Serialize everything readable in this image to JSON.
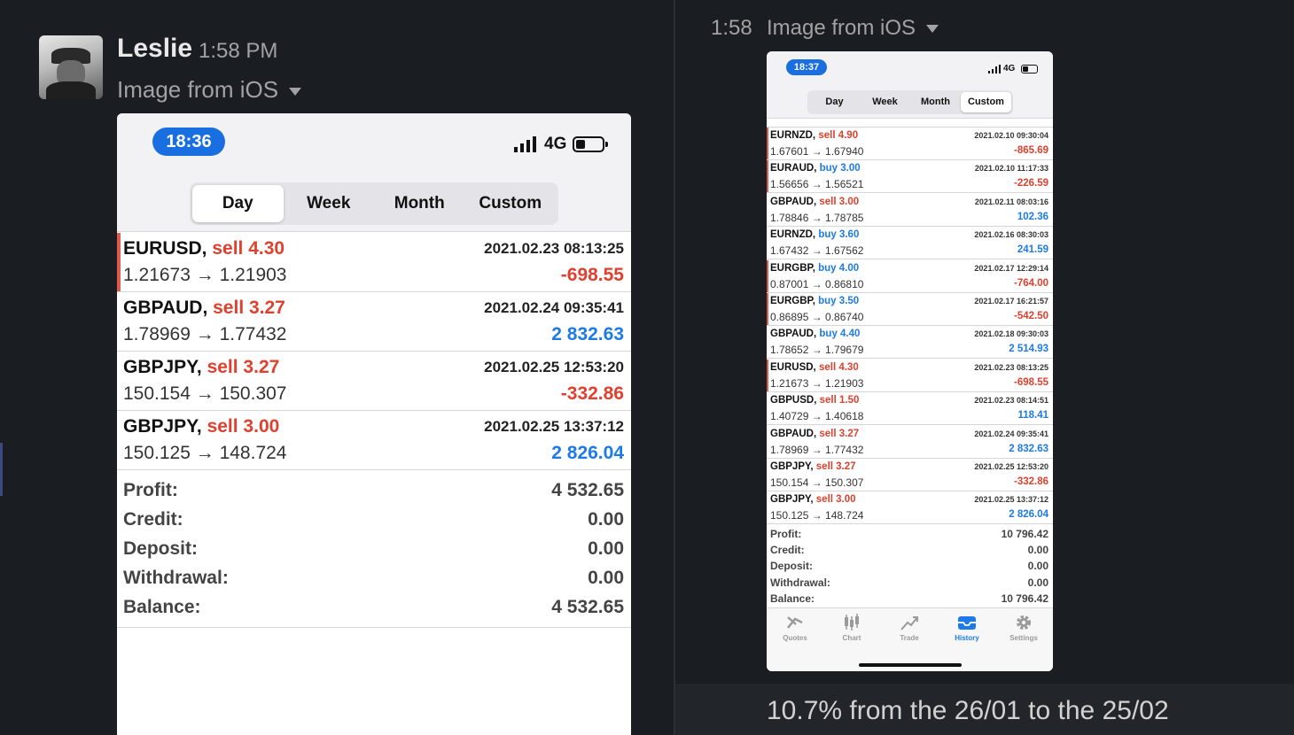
{
  "left_panel": {
    "author": "Leslie",
    "time": "1:58 PM",
    "file_label": "Image from iOS",
    "screenshot": {
      "clock": "18:36",
      "network": "4G",
      "tabs": [
        "Day",
        "Week",
        "Month",
        "Custom"
      ],
      "active_tab": "Day",
      "trades": [
        {
          "symbol": "EURUSD,",
          "side": "sell 4.30",
          "side_type": "sell",
          "date": "2021.02.23 08:13:25",
          "prices": "1.21673 → 1.21903",
          "pl": "-698.55",
          "pl_sign": "neg",
          "marked": true
        },
        {
          "symbol": "GBPAUD,",
          "side": "sell 3.27",
          "side_type": "sell",
          "date": "2021.02.24 09:35:41",
          "prices": "1.78969 → 1.77432",
          "pl": "2 832.63",
          "pl_sign": "pos",
          "marked": false
        },
        {
          "symbol": "GBPJPY,",
          "side": "sell 3.27",
          "side_type": "sell",
          "date": "2021.02.25 12:53:20",
          "prices": "150.154 → 150.307",
          "pl": "-332.86",
          "pl_sign": "neg",
          "marked": false
        },
        {
          "symbol": "GBPJPY,",
          "side": "sell 3.00",
          "side_type": "sell",
          "date": "2021.02.25 13:37:12",
          "prices": "150.125 → 148.724",
          "pl": "2 826.04",
          "pl_sign": "pos",
          "marked": false
        }
      ],
      "summary": [
        {
          "label": "Profit:",
          "value": "4 532.65"
        },
        {
          "label": "Credit:",
          "value": "0.00"
        },
        {
          "label": "Deposit:",
          "value": "0.00"
        },
        {
          "label": "Withdrawal:",
          "value": "0.00"
        },
        {
          "label": "Balance:",
          "value": "4 532.65"
        }
      ]
    }
  },
  "right_panel": {
    "time": "1:58",
    "file_label": "Image from iOS",
    "caption": "10.7% from the 26/01 to the 25/02",
    "screenshot": {
      "clock": "18:37",
      "network": "4G",
      "tabs": [
        "Day",
        "Week",
        "Month",
        "Custom"
      ],
      "active_tab": "Custom",
      "trades": [
        {
          "symbol": "EURNZD,",
          "side": "sell 4.90",
          "side_type": "sell",
          "date": "2021.02.10 09:30:04",
          "prices": "1.67601 → 1.67940",
          "pl": "-865.69",
          "pl_sign": "neg",
          "marked": true
        },
        {
          "symbol": "EURAUD,",
          "side": "buy 3.00",
          "side_type": "buy",
          "date": "2021.02.10 11:17:33",
          "prices": "1.56656 → 1.56521",
          "pl": "-226.59",
          "pl_sign": "neg",
          "marked": true
        },
        {
          "symbol": "GBPAUD,",
          "side": "sell 3.00",
          "side_type": "sell",
          "date": "2021.02.11 08:03:16",
          "prices": "1.78846 → 1.78785",
          "pl": "102.36",
          "pl_sign": "pos",
          "marked": false
        },
        {
          "symbol": "EURNZD,",
          "side": "buy 3.60",
          "side_type": "buy",
          "date": "2021.02.16 08:30:03",
          "prices": "1.67432 → 1.67562",
          "pl": "241.59",
          "pl_sign": "pos",
          "marked": false
        },
        {
          "symbol": "EURGBP,",
          "side": "buy 4.00",
          "side_type": "buy",
          "date": "2021.02.17 12:29:14",
          "prices": "0.87001 → 0.86810",
          "pl": "-764.00",
          "pl_sign": "neg",
          "marked": true
        },
        {
          "symbol": "EURGBP,",
          "side": "buy 3.50",
          "side_type": "buy",
          "date": "2021.02.17 16:21:57",
          "prices": "0.86895 → 0.86740",
          "pl": "-542.50",
          "pl_sign": "neg",
          "marked": true
        },
        {
          "symbol": "GBPAUD,",
          "side": "buy 4.40",
          "side_type": "buy",
          "date": "2021.02.18 09:30:03",
          "prices": "1.78652 → 1.79679",
          "pl": "2 514.93",
          "pl_sign": "pos",
          "marked": false
        },
        {
          "symbol": "EURUSD,",
          "side": "sell 4.30",
          "side_type": "sell",
          "date": "2021.02.23 08:13:25",
          "prices": "1.21673 → 1.21903",
          "pl": "-698.55",
          "pl_sign": "neg",
          "marked": true
        },
        {
          "symbol": "GBPUSD,",
          "side": "sell 1.50",
          "side_type": "sell",
          "date": "2021.02.23 08:14:51",
          "prices": "1.40729 → 1.40618",
          "pl": "118.41",
          "pl_sign": "pos",
          "marked": false
        },
        {
          "symbol": "GBPAUD,",
          "side": "sell 3.27",
          "side_type": "sell",
          "date": "2021.02.24 09:35:41",
          "prices": "1.78969 → 1.77432",
          "pl": "2 832.63",
          "pl_sign": "pos",
          "marked": false
        },
        {
          "symbol": "GBPJPY,",
          "side": "sell 3.27",
          "side_type": "sell",
          "date": "2021.02.25 12:53:20",
          "prices": "150.154 → 150.307",
          "pl": "-332.86",
          "pl_sign": "neg",
          "marked": false
        },
        {
          "symbol": "GBPJPY,",
          "side": "sell 3.00",
          "side_type": "sell",
          "date": "2021.02.25 13:37:12",
          "prices": "150.125 → 148.724",
          "pl": "2 826.04",
          "pl_sign": "pos",
          "marked": false
        }
      ],
      "summary": [
        {
          "label": "Profit:",
          "value": "10 796.42"
        },
        {
          "label": "Credit:",
          "value": "0.00"
        },
        {
          "label": "Deposit:",
          "value": "0.00"
        },
        {
          "label": "Withdrawal:",
          "value": "0.00"
        },
        {
          "label": "Balance:",
          "value": "10 796.42"
        }
      ],
      "bottom_tabs": [
        {
          "label": "Quotes",
          "icon": "quotes-icon"
        },
        {
          "label": "Chart",
          "icon": "chart-icon"
        },
        {
          "label": "Trade",
          "icon": "trade-icon"
        },
        {
          "label": "History",
          "icon": "history-icon",
          "active": true
        },
        {
          "label": "Settings",
          "icon": "gear-icon"
        }
      ]
    }
  },
  "colors": {
    "background": "#1a1d21",
    "sell": "#e0402e",
    "buy": "#1d7ae8",
    "clock_pill": "#1a6fe0"
  }
}
